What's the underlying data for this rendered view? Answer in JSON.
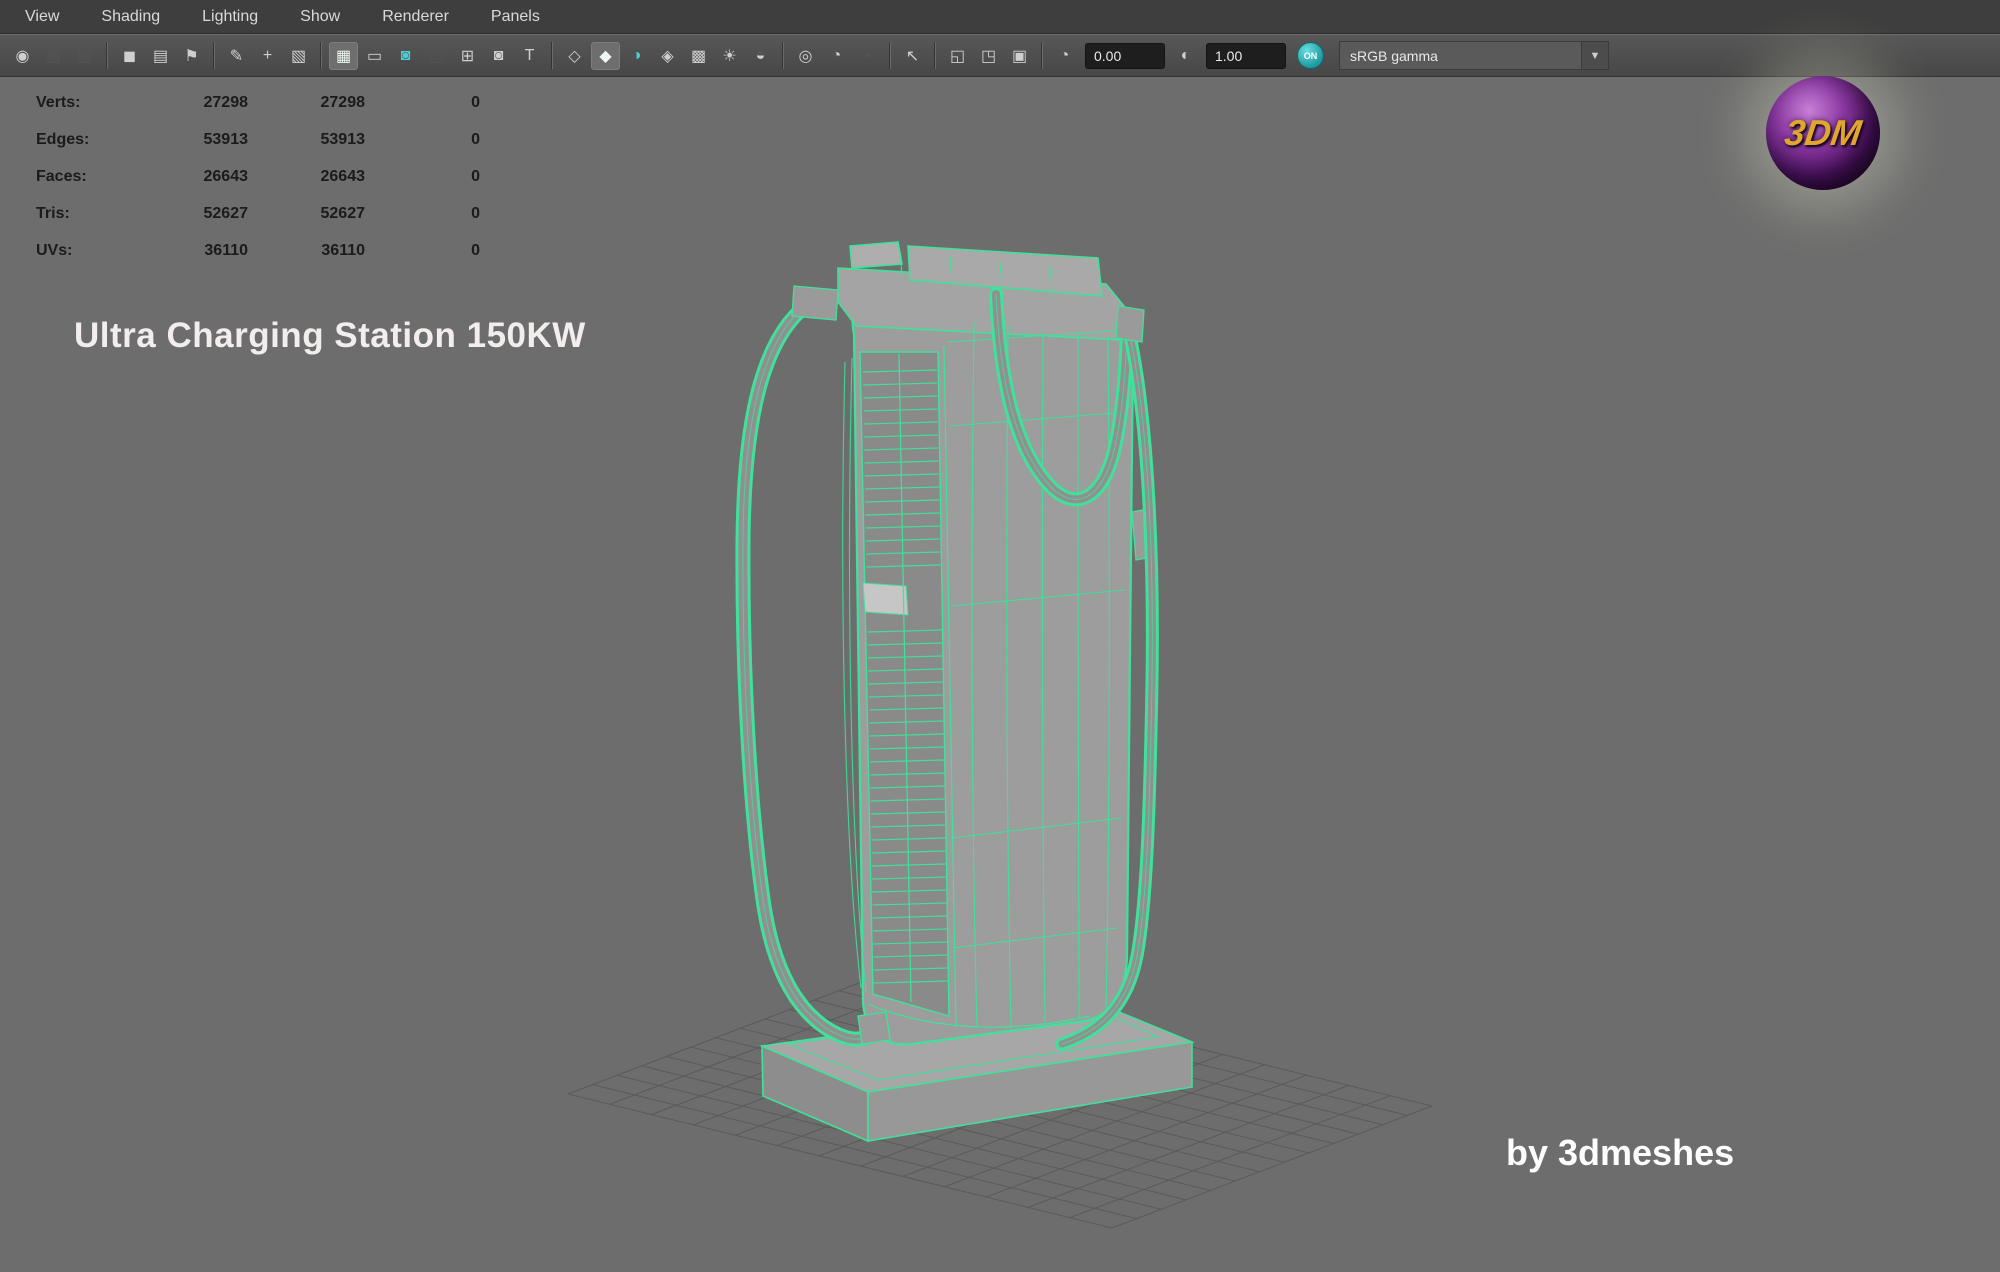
{
  "menu_bar": {
    "items": [
      "View",
      "Shading",
      "Lighting",
      "Show",
      "Renderer",
      "Panels"
    ]
  },
  "toolbar": {
    "items": [
      {
        "type": "icon",
        "name": "show-manipulators-icon",
        "glyph": "◉"
      },
      {
        "type": "icon",
        "name": "unused-slot-a-icon",
        "glyph": "▨",
        "state": "disabled"
      },
      {
        "type": "icon",
        "name": "unused-slot-b-icon",
        "glyph": "▨",
        "state": "disabled"
      },
      {
        "type": "sep"
      },
      {
        "type": "icon",
        "name": "select-camera-icon",
        "glyph": "◼"
      },
      {
        "type": "icon",
        "name": "camera-attributes-icon",
        "glyph": "▤"
      },
      {
        "type": "icon",
        "name": "camera-bookmark-icon",
        "glyph": "⚑"
      },
      {
        "type": "sep"
      },
      {
        "type": "icon",
        "name": "grease-pencil-icon",
        "glyph": "✎"
      },
      {
        "type": "icon",
        "name": "pan-zoom-icon",
        "glyph": "+"
      },
      {
        "type": "icon",
        "name": "image-plane-icon",
        "glyph": "▧"
      },
      {
        "type": "sep"
      },
      {
        "type": "icon",
        "name": "grid-toggle-icon",
        "glyph": "▦",
        "state": "active"
      },
      {
        "type": "icon",
        "name": "film-gate-icon",
        "glyph": "▭"
      },
      {
        "type": "icon",
        "name": "resolution-gate-icon",
        "glyph": "◙",
        "state": "accent"
      },
      {
        "type": "icon",
        "name": "gate-mask-icon",
        "glyph": "▢",
        "state": "disabled"
      },
      {
        "type": "icon",
        "name": "field-chart-icon",
        "glyph": "⊞"
      },
      {
        "type": "icon",
        "name": "safe-action-icon",
        "glyph": "◙"
      },
      {
        "type": "icon",
        "name": "safe-title-icon",
        "glyph": "T"
      },
      {
        "type": "sep"
      },
      {
        "type": "icon",
        "name": "wireframe-cube-icon",
        "glyph": "◇"
      },
      {
        "type": "icon",
        "name": "shaded-cube-icon",
        "glyph": "◆",
        "state": "active"
      },
      {
        "type": "icon",
        "name": "textured-cube-icon",
        "glyph": "◑",
        "state": "accent"
      },
      {
        "type": "icon",
        "name": "material-cube-icon",
        "glyph": "◈"
      },
      {
        "type": "icon",
        "name": "checker-display-icon",
        "glyph": "▩"
      },
      {
        "type": "icon",
        "name": "lights-icon",
        "glyph": "☀"
      },
      {
        "type": "icon",
        "name": "shadows-icon",
        "glyph": "◒"
      },
      {
        "type": "sep"
      },
      {
        "type": "icon",
        "name": "occlusion-icon",
        "glyph": "◎"
      },
      {
        "type": "icon",
        "name": "motion-blur-icon",
        "glyph": "◔"
      },
      {
        "type": "icon",
        "name": "isolate-select-icon",
        "glyph": "▪",
        "state": "disabled"
      },
      {
        "type": "sep"
      },
      {
        "type": "icon",
        "name": "select-highlight-icon",
        "glyph": "↖"
      },
      {
        "type": "sep"
      },
      {
        "type": "icon",
        "name": "copy-layout-icon",
        "glyph": "◱"
      },
      {
        "type": "icon",
        "name": "paste-layout-icon",
        "glyph": "◳"
      },
      {
        "type": "icon",
        "name": "pin-layout-icon",
        "glyph": "▣"
      },
      {
        "type": "sep"
      },
      {
        "type": "icon",
        "name": "exposure-icon",
        "glyph": "◔"
      },
      {
        "type": "field",
        "name": "exposure-input",
        "value": "0.00"
      },
      {
        "type": "icon",
        "name": "gamma-icon",
        "glyph": "◐"
      },
      {
        "type": "field",
        "name": "gamma-input",
        "value": "1.00"
      },
      {
        "type": "toggle",
        "name": "color-management-toggle",
        "label": "ON"
      },
      {
        "type": "select",
        "name": "colorspace-select",
        "value": "sRGB gamma"
      }
    ]
  },
  "hud": {
    "rows": [
      {
        "label": "Verts:",
        "total": "27298",
        "selected": "27298",
        "other": "0"
      },
      {
        "label": "Edges:",
        "total": "53913",
        "selected": "53913",
        "other": "0"
      },
      {
        "label": "Faces:",
        "total": "26643",
        "selected": "26643",
        "other": "0"
      },
      {
        "label": "Tris:",
        "total": "52627",
        "selected": "52627",
        "other": "0"
      },
      {
        "label": "UVs:",
        "total": "36110",
        "selected": "36110",
        "other": "0"
      }
    ]
  },
  "overlay": {
    "title": "Ultra Charging Station 150KW",
    "credit": "by 3dmeshes",
    "logo_text": "3DM"
  },
  "colors": {
    "wireframe": "#3fe29a",
    "accent_teal": "#46d2d6",
    "logo_purple": "#581570",
    "viewport_gray": "#6d6d6d"
  }
}
